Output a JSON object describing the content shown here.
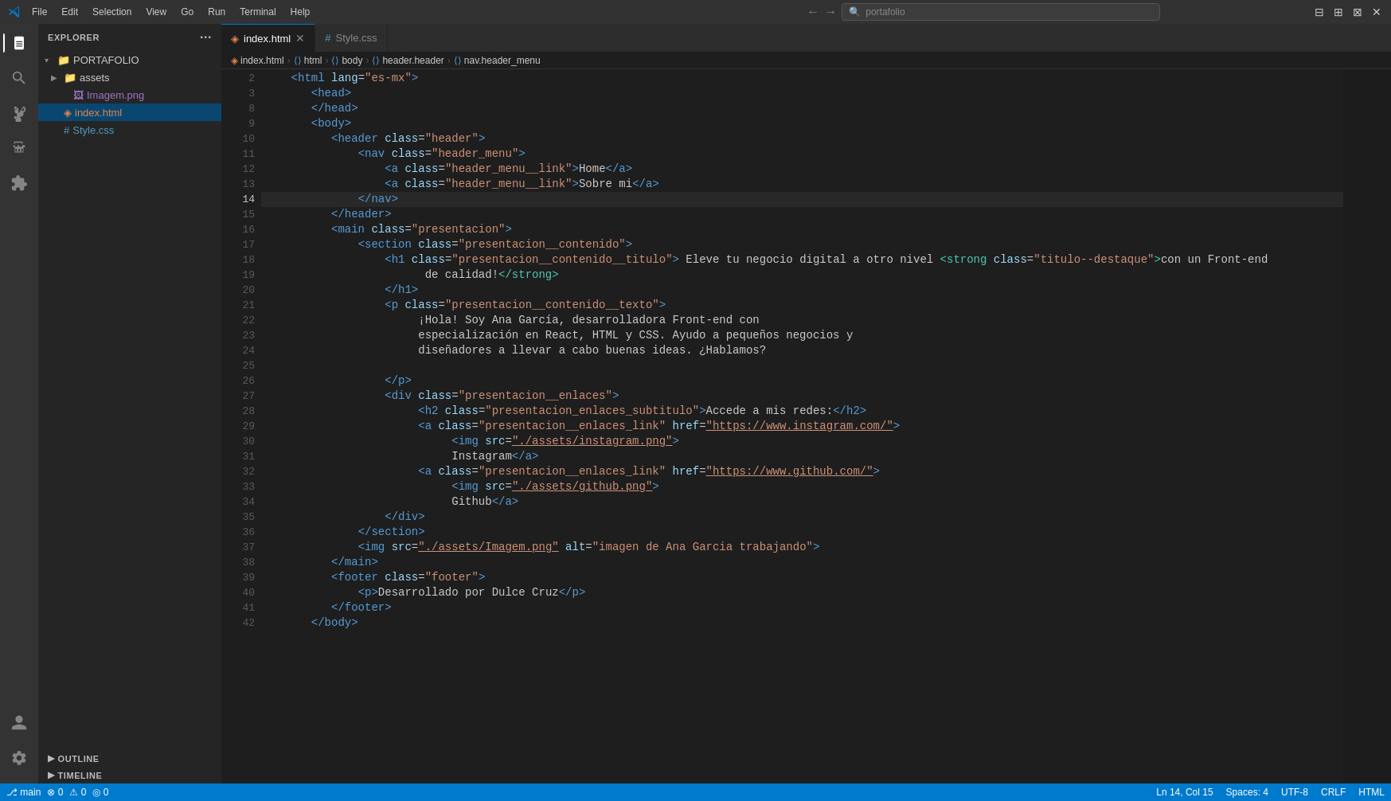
{
  "titleBar": {
    "appIcon": "◆",
    "menuItems": [
      "File",
      "Edit",
      "Selection",
      "View",
      "Go",
      "Run",
      "Terminal",
      "Help"
    ],
    "navBack": "←",
    "navForward": "→",
    "searchPlaceholder": "portafolio",
    "windowButtons": [
      "⊞",
      "⊟",
      "⊠",
      "✕"
    ]
  },
  "activityBar": {
    "items": [
      {
        "icon": "⎘",
        "label": "explorer-icon",
        "active": true
      },
      {
        "icon": "🔍",
        "label": "search-icon",
        "active": false
      },
      {
        "icon": "⑂",
        "label": "source-control-icon",
        "active": false
      },
      {
        "icon": "▷",
        "label": "run-debug-icon",
        "active": false
      },
      {
        "icon": "⊞",
        "label": "extensions-icon",
        "active": false
      }
    ],
    "bottomItems": [
      {
        "icon": "👤",
        "label": "account-icon"
      },
      {
        "icon": "⚙",
        "label": "settings-icon"
      }
    ]
  },
  "sidebar": {
    "title": "EXPLORER",
    "moreOptions": "···",
    "rootFolder": "PORTAFOLIO",
    "tree": [
      {
        "id": "assets",
        "type": "folder",
        "label": "assets",
        "indent": 1,
        "arrow": "▶"
      },
      {
        "id": "imagem-png",
        "type": "png",
        "label": "Imagem.png",
        "indent": 2
      },
      {
        "id": "index-html",
        "type": "html",
        "label": "index.html",
        "indent": 1,
        "active": true
      },
      {
        "id": "style-css",
        "type": "css",
        "label": "Style.css",
        "indent": 1
      }
    ],
    "outlineLabel": "OUTLINE",
    "timelineLabel": "TIMELINE"
  },
  "tabs": [
    {
      "id": "index-html",
      "label": "index.html",
      "type": "html",
      "active": true,
      "dirty": false
    },
    {
      "id": "style-css",
      "label": "Style.css",
      "type": "css",
      "active": false,
      "dirty": false
    }
  ],
  "breadcrumb": {
    "items": [
      "index.html",
      "html",
      "body",
      "header.header",
      "nav.header_menu"
    ]
  },
  "editor": {
    "lines": [
      {
        "num": 2,
        "content": "<html lang=\"es-mx\">",
        "type": "code"
      },
      {
        "num": 3,
        "content": "   <head>",
        "type": "code"
      },
      {
        "num": 8,
        "content": "   </head>",
        "type": "code"
      },
      {
        "num": 9,
        "content": "   <body>",
        "type": "code"
      },
      {
        "num": 10,
        "content": "      <header class=\"header\">",
        "type": "code"
      },
      {
        "num": 11,
        "content": "         <nav class=\"header_menu\">",
        "type": "code"
      },
      {
        "num": 12,
        "content": "            <a class=\"header_menu__link\">Home</a>",
        "type": "code"
      },
      {
        "num": 13,
        "content": "            <a class=\"header_menu__link\">Sobre mi</a>",
        "type": "code"
      },
      {
        "num": 14,
        "content": "         </nav>",
        "type": "code",
        "active": true
      },
      {
        "num": 15,
        "content": "      </header>",
        "type": "code"
      },
      {
        "num": 16,
        "content": "      <main class=\"presentacion\">",
        "type": "code"
      },
      {
        "num": 17,
        "content": "         <section class=\"presentacion__contenido\">",
        "type": "code"
      },
      {
        "num": 18,
        "content": "            <h1 class=\"presentacion__contenido__titulo\"> Eleve tu negocio digital a otro nivel <strong class=\"titulo--destaque\">con un Front-end",
        "type": "code"
      },
      {
        "num": 19,
        "content": "                de calidad!</strong>",
        "type": "code"
      },
      {
        "num": 20,
        "content": "            </h1>",
        "type": "code"
      },
      {
        "num": 21,
        "content": "            <p class=\"presentacion__contenido__texto\">",
        "type": "code"
      },
      {
        "num": 22,
        "content": "               ¡Hola! Soy Ana García, desarrolladora Front-end con",
        "type": "code"
      },
      {
        "num": 23,
        "content": "               especialización en React, HTML y CSS. Ayudo a pequeños negocios y",
        "type": "code"
      },
      {
        "num": 24,
        "content": "               diseñadores a llevar a cabo buenas ideas. ¿Hablamos?",
        "type": "code"
      },
      {
        "num": 25,
        "content": "",
        "type": "code"
      },
      {
        "num": 26,
        "content": "            </p>",
        "type": "code"
      },
      {
        "num": 27,
        "content": "            <div class=\"presentacion__enlaces\">",
        "type": "code"
      },
      {
        "num": 28,
        "content": "               <h2 class=\"presentacion_enlaces_subtitulo\">Accede a mis redes:</h2>",
        "type": "code"
      },
      {
        "num": 29,
        "content": "               <a class=\"presentacion__enlaces_link\" href=\"https://www.instagram.com/\">",
        "type": "code"
      },
      {
        "num": 30,
        "content": "                  <img src=\"./assets/instagram.png\">",
        "type": "code"
      },
      {
        "num": 31,
        "content": "                  Instagram</a>",
        "type": "code"
      },
      {
        "num": 32,
        "content": "               <a class=\"presentacion__enlaces_link\" href=\"https://www.github.com/\">",
        "type": "code"
      },
      {
        "num": 33,
        "content": "                  <img src=\"./assets/github.png\">",
        "type": "code"
      },
      {
        "num": 34,
        "content": "                  Github</a>",
        "type": "code"
      },
      {
        "num": 35,
        "content": "            </div>",
        "type": "code"
      },
      {
        "num": 36,
        "content": "         </section>",
        "type": "code"
      },
      {
        "num": 37,
        "content": "            <img src=\"./assets/Imagem.png\" alt=\"imagen de Ana Garcia trabajando\">",
        "type": "code"
      },
      {
        "num": 38,
        "content": "      </main>",
        "type": "code"
      },
      {
        "num": 39,
        "content": "      <footer class=\"footer\">",
        "type": "code"
      },
      {
        "num": 40,
        "content": "         <p>Desarrollado por Dulce Cruz</p>",
        "type": "code"
      },
      {
        "num": 41,
        "content": "      </footer>",
        "type": "code"
      },
      {
        "num": 42,
        "content": "   </body>",
        "type": "code"
      }
    ]
  },
  "statusBar": {
    "gitBranch": "⎇  main",
    "errors": "⊗ 0",
    "warnings": "⚠ 0",
    "info": "◎ 0",
    "position": "Ln 14, Col 15",
    "spaces": "Spaces: 4",
    "encoding": "UTF-8",
    "lineEnding": "CRLF",
    "language": "HTML"
  }
}
